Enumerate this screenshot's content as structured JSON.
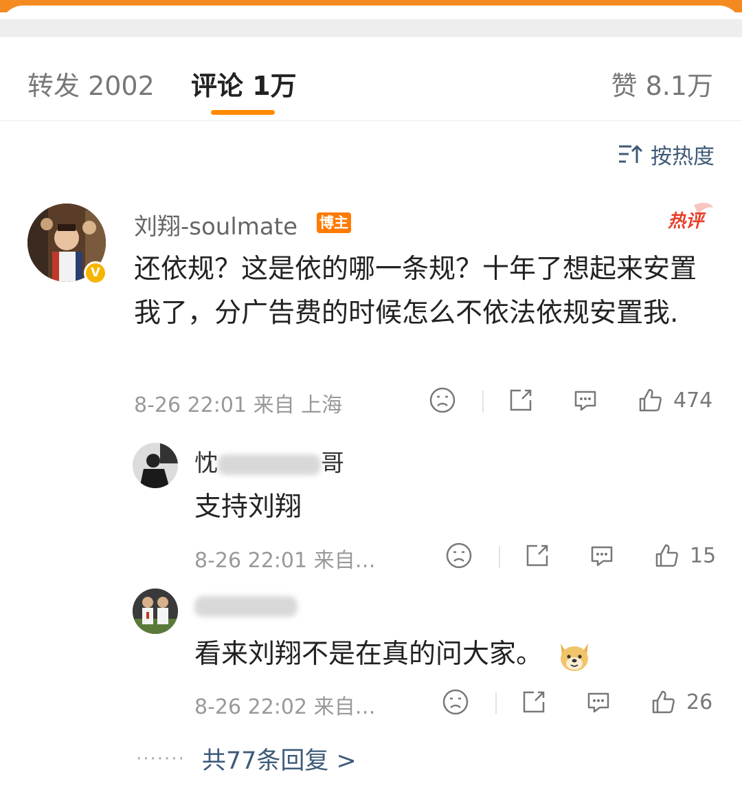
{
  "tabs": {
    "forward": "转发 2002",
    "comment": "评论 1万",
    "like": "赞 8.1万"
  },
  "sort_label": "按热度",
  "comment": {
    "username": "刘翔-soulmate",
    "badge": "博主",
    "hot_tag": "热评",
    "text": "还依规？这是依的哪一条规？十年了想起来安置我了，分广告费的时候怎么不依法依规安置我.",
    "meta": "8-26 22:01 来自 上海",
    "likes": "474"
  },
  "replies": [
    {
      "name_visible_prefix": "忱",
      "name_visible_suffix": "哥",
      "text": "支持刘翔",
      "meta": "8-26 22:01 来自…",
      "likes": "15"
    },
    {
      "name_visible_prefix": "",
      "name_visible_suffix": "",
      "text": "看来刘翔不是在真的问大家。",
      "meta": "8-26 22:02 来自…",
      "likes": "26"
    }
  ],
  "more_replies": "共77条回复 >",
  "colors": {
    "accent": "#ff8a00",
    "link": "#3e5a78",
    "hot": "#e8402a"
  }
}
